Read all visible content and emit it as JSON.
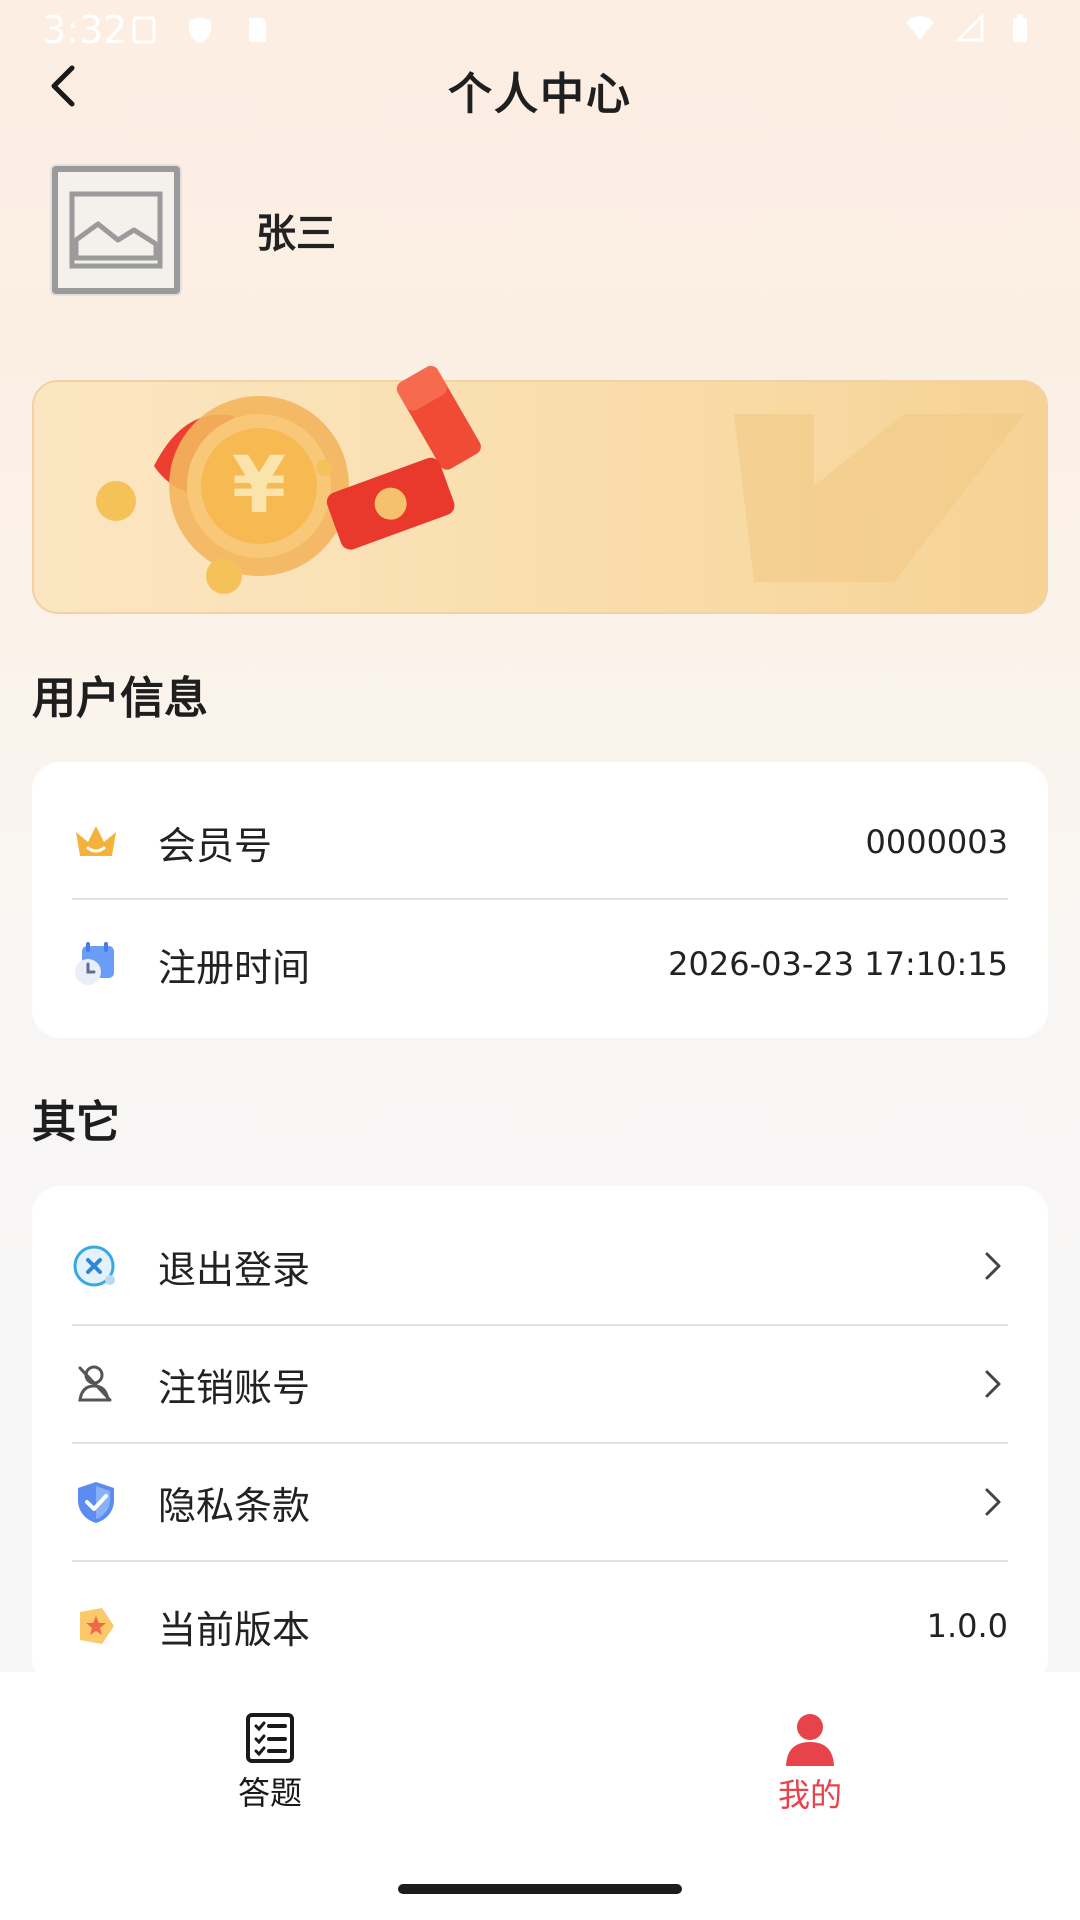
{
  "status_bar": {
    "time": "3:32"
  },
  "header": {
    "title": "个人中心"
  },
  "profile": {
    "username": "张三"
  },
  "user_info": {
    "section_title": "用户信息",
    "rows": [
      {
        "label": "会员号",
        "value": "0000003",
        "icon": "crown-icon"
      },
      {
        "label": "注册时间",
        "value": "2026-03-23 17:10:15",
        "icon": "calendar-clock-icon"
      }
    ]
  },
  "other": {
    "section_title": "其它",
    "rows": [
      {
        "label": "退出登录",
        "icon": "logout-icon"
      },
      {
        "label": "注销账号",
        "icon": "user-remove-icon"
      },
      {
        "label": "隐私条款",
        "icon": "shield-check-icon"
      },
      {
        "label": "当前版本",
        "value": "1.0.0",
        "icon": "star-badge-icon"
      }
    ]
  },
  "tabbar": {
    "tabs": [
      {
        "label": "答题",
        "icon": "checklist-icon",
        "active": false
      },
      {
        "label": "我的",
        "icon": "person-icon",
        "active": true
      }
    ],
    "active_color": "#e8424a",
    "inactive_color": "#1a1a1a"
  },
  "colors": {
    "accent_red": "#e8424a",
    "banner_gold": "#f8d9a2"
  }
}
